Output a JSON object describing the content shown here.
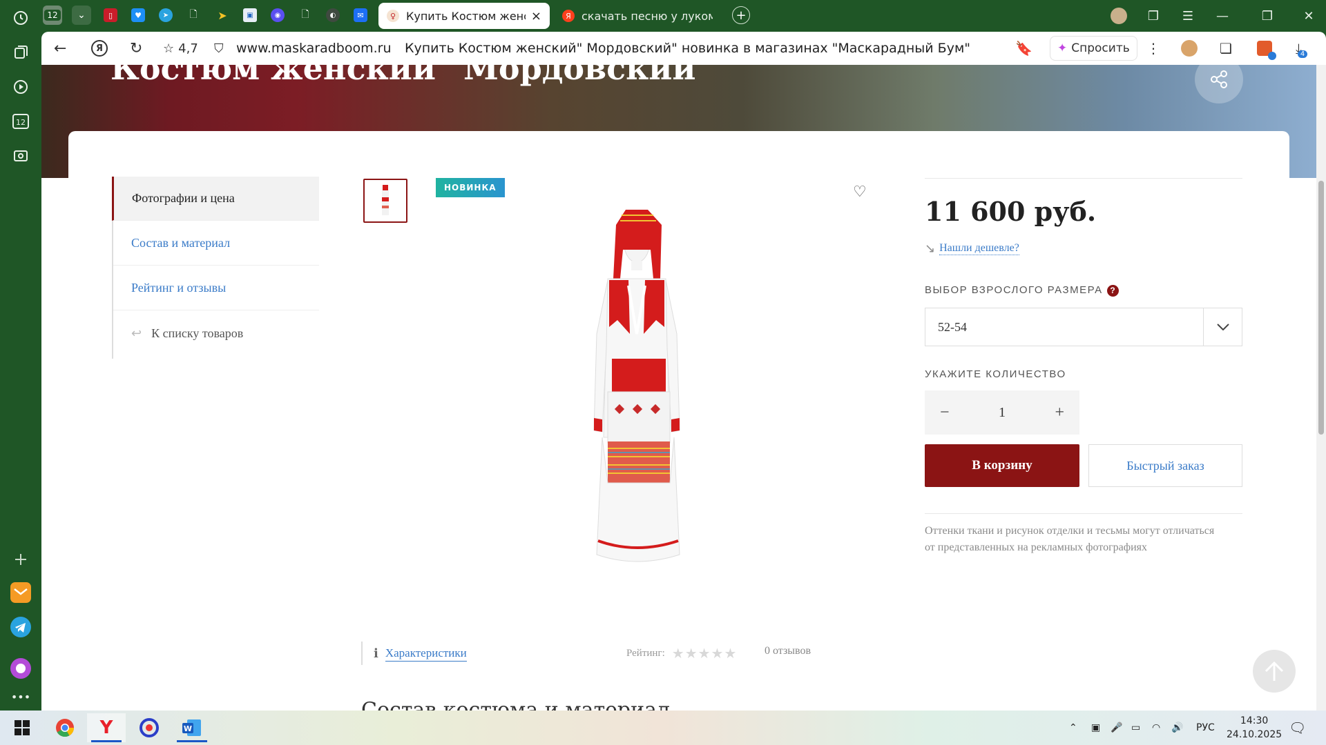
{
  "browser": {
    "tab_count_badge": "12",
    "tabs": [
      {
        "title": "Купить Костюм женский",
        "active": true
      },
      {
        "title": "скачать песню у лукомор",
        "active": false
      }
    ],
    "rating": "4,7",
    "url": "www.maskaradboom.ru",
    "page_title": "Купить Костюм женский\" Мордовский\" новинка в магазинах \"Маскарадный Бум\"",
    "ask_label": "Спросить",
    "downloads_badge": "4"
  },
  "hero": {
    "title": "Костюм женский\" Мордовский\""
  },
  "sidenav": {
    "items": [
      {
        "label": "Фотографии и цена"
      },
      {
        "label": "Состав и материал"
      },
      {
        "label": "Рейтинг и отзывы"
      },
      {
        "label": "К списку товаров"
      }
    ]
  },
  "product": {
    "badge": "НОВИНКА",
    "price": "11 600 руб.",
    "cheaper_link": "Нашли дешевле?",
    "size_label": "ВЫБОР ВЗРОСЛОГО РАЗМЕРА",
    "size_help": "?",
    "size_value": "52-54",
    "qty_label": "УКАЖИТЕ КОЛИЧЕСТВО",
    "qty_minus": "−",
    "qty_value": "1",
    "qty_plus": "+",
    "cart_button": "В корзину",
    "quick_order_button": "Быстрый заказ",
    "note": "Оттенки ткани и рисунок отделки и тесьмы могут отличаться от представленных на рекламных фотографиях"
  },
  "bottom": {
    "characteristics_link": "Характеристики",
    "rating_label": "Рейтинг:",
    "stars": "★★★★★",
    "reviews": "0 отзывов",
    "section_title": "Состав костюма и материал"
  },
  "taskbar": {
    "lang": "РУС",
    "time": "14:30",
    "date": "24.10.2025"
  },
  "colors": {
    "brand": "#8b1414",
    "link": "#3a7bc8",
    "browser_frame": "#1f5626"
  }
}
